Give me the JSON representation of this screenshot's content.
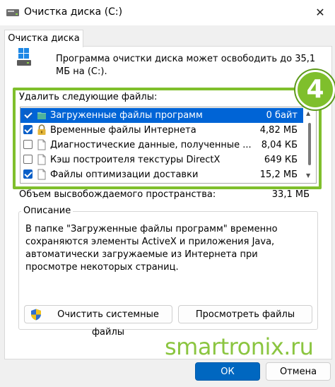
{
  "window": {
    "title": "Очистка диска  (C:)",
    "close_glyph": "✕"
  },
  "tab": {
    "label": "Очистка диска"
  },
  "intro_text": "Программа очистки диска может освободить до 35,1 МБ на (C:).",
  "files_section": {
    "label": "Удалить следующие файлы:",
    "items": [
      {
        "name": "Загруженные файлы программ",
        "size": "0 байт",
        "checked": true,
        "selected": true,
        "icon": "folder-icon"
      },
      {
        "name": "Временные файлы Интернета",
        "size": "4,82 МБ",
        "checked": true,
        "selected": false,
        "icon": "lock-icon"
      },
      {
        "name": "Диагностические данные, полученные ...",
        "size": "8,04 КБ",
        "checked": false,
        "selected": false,
        "icon": "file-icon"
      },
      {
        "name": "Кэш построителя текстуры DirectX",
        "size": "649 КБ",
        "checked": false,
        "selected": false,
        "icon": "file-icon"
      },
      {
        "name": "Файлы оптимизации доставки",
        "size": "15,2 МБ",
        "checked": true,
        "selected": false,
        "icon": "file-icon"
      }
    ]
  },
  "step_badge": "4",
  "freed": {
    "label": "Объем высвобождаемого пространства:",
    "value": "33,1 МБ"
  },
  "description": {
    "legend": "Описание",
    "text": "В папке \"Загруженные файлы программ\" временно сохраняются элементы ActiveX и приложения Java, автоматически загружаемые из Интернета при просмотре некоторых страниц."
  },
  "buttons": {
    "clean_system": "Очистить системные файлы",
    "view_files": "Просмотреть файлы",
    "ok": "ОК",
    "cancel": "Отмена"
  },
  "watermark": "smartronix.ru",
  "colors": {
    "accent": "#0067c0",
    "highlight": "#7fbf2c",
    "selection": "#0064d6"
  }
}
